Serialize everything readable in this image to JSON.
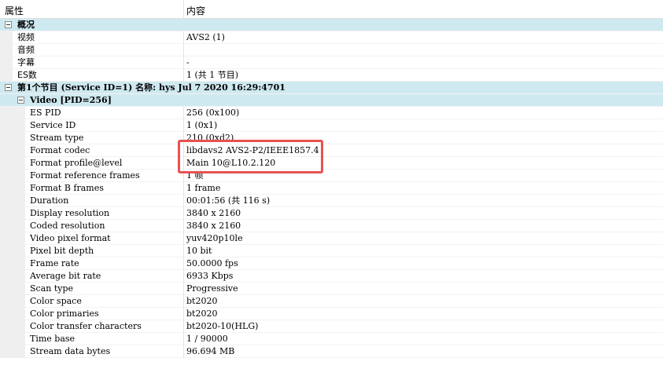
{
  "header": {
    "col1": "属性",
    "col2": "内容"
  },
  "rows": [
    {
      "type": "group",
      "level": 0,
      "label": "概况",
      "value": ""
    },
    {
      "type": "prop",
      "level": 0,
      "label": "视频",
      "value": "AVS2 (1)"
    },
    {
      "type": "prop",
      "level": 0,
      "label": "音频",
      "value": ""
    },
    {
      "type": "prop",
      "level": 0,
      "label": "字幕",
      "value": "-"
    },
    {
      "type": "prop",
      "level": 0,
      "label": "ES数",
      "value": "1 (共 1 节目)"
    },
    {
      "type": "group",
      "level": 0,
      "label": "第1个节目 (Service ID=1) 名称: hys Jul  7 2020 16:29:4701",
      "value": ""
    },
    {
      "type": "group",
      "level": 1,
      "label": "Video [PID=256]",
      "value": ""
    },
    {
      "type": "prop",
      "level": 2,
      "label": "ES PID",
      "value": "256 (0x100)"
    },
    {
      "type": "prop",
      "level": 2,
      "label": "Service ID",
      "value": "1 (0x1)"
    },
    {
      "type": "prop",
      "level": 2,
      "label": "Stream type",
      "value": "210 (0xd2)"
    },
    {
      "type": "prop",
      "level": 2,
      "label": "Format codec",
      "value": "libdavs2 AVS2-P2/IEEE1857.4"
    },
    {
      "type": "prop",
      "level": 2,
      "label": "Format profile@level",
      "value": "Main 10@L10.2.120"
    },
    {
      "type": "prop",
      "level": 2,
      "label": "Format reference frames",
      "value": "1 帧"
    },
    {
      "type": "prop",
      "level": 2,
      "label": "Format B frames",
      "value": "1 frame"
    },
    {
      "type": "prop",
      "level": 2,
      "label": "Duration",
      "value": "00:01:56 (共 116 s)"
    },
    {
      "type": "prop",
      "level": 2,
      "label": "Display resolution",
      "value": "3840 x 2160"
    },
    {
      "type": "prop",
      "level": 2,
      "label": "Coded resolution",
      "value": "3840 x 2160"
    },
    {
      "type": "prop",
      "level": 2,
      "label": "Video pixel format",
      "value": "yuv420p10le"
    },
    {
      "type": "prop",
      "level": 2,
      "label": "Pixel bit depth",
      "value": "10 bit"
    },
    {
      "type": "prop",
      "level": 2,
      "label": "Frame rate",
      "value": "50.0000 fps"
    },
    {
      "type": "prop",
      "level": 2,
      "label": "Average bit rate",
      "value": "6933 Kbps"
    },
    {
      "type": "prop",
      "level": 2,
      "label": "Scan type",
      "value": "Progressive"
    },
    {
      "type": "prop",
      "level": 2,
      "label": "Color space",
      "value": "bt2020"
    },
    {
      "type": "prop",
      "level": 2,
      "label": "Color primaries",
      "value": "bt2020"
    },
    {
      "type": "prop",
      "level": 2,
      "label": "Color transfer characters",
      "value": "bt2020-10(HLG)"
    },
    {
      "type": "prop",
      "level": 2,
      "label": "Time base",
      "value": "1 / 90000"
    },
    {
      "type": "prop",
      "level": 2,
      "label": "Stream data bytes",
      "value": "96.694 MB"
    }
  ],
  "colors": {
    "group_bg": "#cfe9f0",
    "highlight": "#e8514f",
    "gutter": "#efefef"
  }
}
